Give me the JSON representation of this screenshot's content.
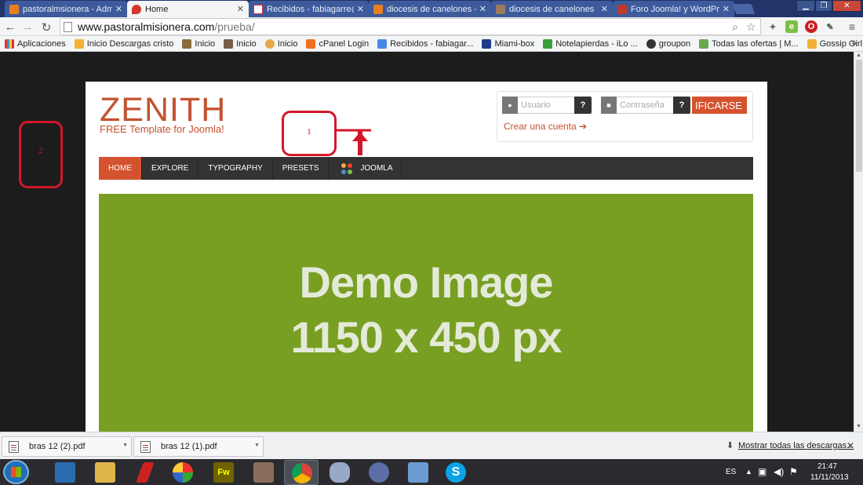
{
  "browser": {
    "tabs": [
      {
        "title": "pastoralmsionera - Admin",
        "active": false
      },
      {
        "title": "Home",
        "active": true
      },
      {
        "title": "Recibidos - fabiagarre@gm",
        "active": false
      },
      {
        "title": "diocesis de canelones - Acti",
        "active": false
      },
      {
        "title": "diocesis de canelones",
        "active": false
      },
      {
        "title": "Foro Joomla! y WordPress",
        "active": false
      }
    ],
    "url_host": "www.pastoralmisionera.com",
    "url_path": "/prueba/",
    "bookmarks": [
      "Aplicaciones",
      "Inicio Descargas cristo",
      "Inicio",
      "Inicio",
      "Inicio",
      "cPanel Login",
      "Recibidos - fabiagar...",
      "Miami-box",
      "Notelapierdas - iLo ...",
      "groupon",
      "Todas las ofertas | M...",
      "Gossip Girl ver onlin..."
    ]
  },
  "site": {
    "logo_title": "ZENITH",
    "logo_subtitle": "FREE Template for Joomla!",
    "login": {
      "username_placeholder": "Usuario",
      "password_placeholder": "Contraseña",
      "help_glyph": "?",
      "submit_label": "IFICARSE",
      "create_account": "Crear una cuenta ➔"
    },
    "nav": [
      "HOME",
      "EXPLORE",
      "TYPOGRAPHY",
      "PRESETS",
      "JOOMLA"
    ],
    "hero_line1": "Demo Image",
    "hero_line2": "1150 x 450 px"
  },
  "annotations": {
    "box1": "1",
    "box2": "2"
  },
  "downloads": {
    "items": [
      "bras 12 (2).pdf",
      "bras 12 (1).pdf"
    ],
    "show_all": "Mostrar todas las descargas..."
  },
  "taskbar": {
    "lang": "ES",
    "time": "21:47",
    "date": "11/11/2013"
  },
  "colors": {
    "accent": "#d4522e",
    "hero": "#789f22",
    "annotation": "#d3172b"
  }
}
